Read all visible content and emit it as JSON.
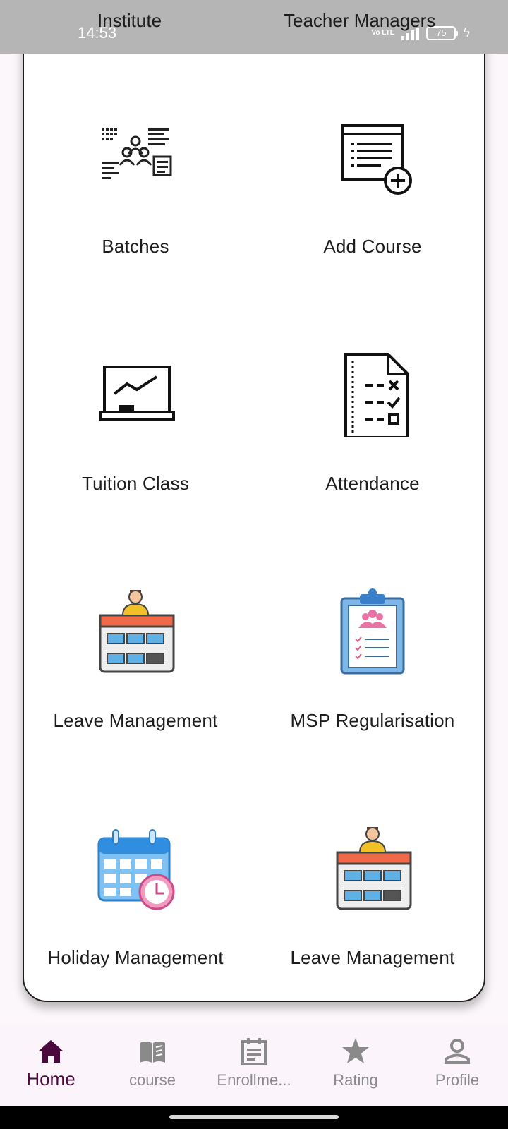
{
  "status_bar": {
    "time": "14:53",
    "network": "Vo LTE",
    "battery": "75"
  },
  "header": {
    "left_label": "Institute",
    "right_label": "Teacher Managers"
  },
  "tiles": [
    {
      "label": "Batches",
      "icon": "batches-icon"
    },
    {
      "label": "Add Course",
      "icon": "add-course-icon"
    },
    {
      "label": "Tuition Class",
      "icon": "whiteboard-icon"
    },
    {
      "label": "Attendance",
      "icon": "checklist-icon"
    },
    {
      "label": "Leave Management",
      "icon": "leave-calendar-icon"
    },
    {
      "label": "MSP Regularisation",
      "icon": "clipboard-icon"
    },
    {
      "label": "Holiday Management",
      "icon": "holiday-calendar-icon"
    },
    {
      "label": "Leave Management",
      "icon": "leave-calendar-icon"
    }
  ],
  "bottom_nav": {
    "items": [
      {
        "label": "Home",
        "icon": "home-icon",
        "active": true
      },
      {
        "label": "course",
        "icon": "book-icon",
        "active": false
      },
      {
        "label": "Enrollme...",
        "icon": "enrollment-icon",
        "active": false
      },
      {
        "label": "Rating",
        "icon": "star-icon",
        "active": false
      },
      {
        "label": "Profile",
        "icon": "person-icon",
        "active": false
      }
    ]
  },
  "colors": {
    "active_nav": "#4a0a3e",
    "inactive_nav": "#8a8a8a",
    "status_bar": "#b5b5b5"
  }
}
